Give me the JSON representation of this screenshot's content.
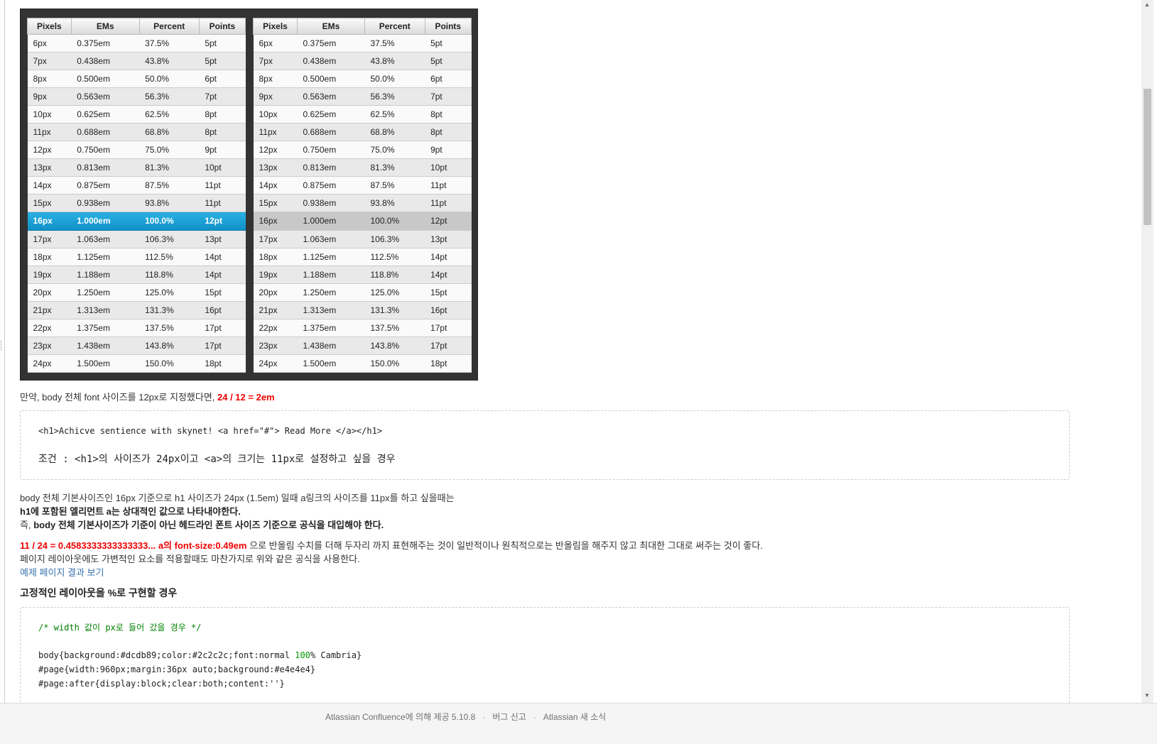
{
  "table": {
    "headers": [
      "Pixels",
      "EMs",
      "Percent",
      "Points"
    ],
    "rows": [
      [
        "6px",
        "0.375em",
        "37.5%",
        "5pt"
      ],
      [
        "7px",
        "0.438em",
        "43.8%",
        "5pt"
      ],
      [
        "8px",
        "0.500em",
        "50.0%",
        "6pt"
      ],
      [
        "9px",
        "0.563em",
        "56.3%",
        "7pt"
      ],
      [
        "10px",
        "0.625em",
        "62.5%",
        "8pt"
      ],
      [
        "11px",
        "0.688em",
        "68.8%",
        "8pt"
      ],
      [
        "12px",
        "0.750em",
        "75.0%",
        "9pt"
      ],
      [
        "13px",
        "0.813em",
        "81.3%",
        "10pt"
      ],
      [
        "14px",
        "0.875em",
        "87.5%",
        "11pt"
      ],
      [
        "15px",
        "0.938em",
        "93.8%",
        "11pt"
      ],
      [
        "16px",
        "1.000em",
        "100.0%",
        "12pt"
      ],
      [
        "17px",
        "1.063em",
        "106.3%",
        "13pt"
      ],
      [
        "18px",
        "1.125em",
        "112.5%",
        "14pt"
      ],
      [
        "19px",
        "1.188em",
        "118.8%",
        "14pt"
      ],
      [
        "20px",
        "1.250em",
        "125.0%",
        "15pt"
      ],
      [
        "21px",
        "1.313em",
        "131.3%",
        "16pt"
      ],
      [
        "22px",
        "1.375em",
        "137.5%",
        "17pt"
      ],
      [
        "23px",
        "1.438em",
        "143.8%",
        "17pt"
      ],
      [
        "24px",
        "1.500em",
        "150.0%",
        "18pt"
      ]
    ],
    "highlight_index": 10,
    "highlight_color_left": "#1aa3d9",
    "highlight_color_right": "#c8c8c8"
  },
  "text": {
    "body_size_note": "만약, body 전체 font 사이즈를 12px로 지정했다면, ",
    "body_size_formula": "24 / 12 = 2em",
    "code1_line1": "<h1>Achicve sentience with skynet! <a href=\"#\"> Read More </a></h1>",
    "code1_condition": "조건 : <h1>의 사이즈가 24px이고 <a>의 크기는 11px로 설정하고 싶을 경우",
    "para1": "body 전체 기본사이즈인 16px 기준으로 h1 사이즈가 24px (1.5em) 일때 a링크의 사이즈를 11px를 하고 싶을때는",
    "para2": "h1에 포함된 엘리먼트 a는 상대적인 값으로 나타내야한다.",
    "para3_prefix": "즉, ",
    "para3_bold": "body 전체 기본사이즈가 기준이 아닌 헤드라인 폰트 사이즈 기준으로 공식을 대입해야 한다.",
    "formula_red": "11 / 24 = 0.4583333333333333... a의 font-size:0.49em",
    "formula_rest": " 으로 반올림 수치를 더해 두자리 까지 표현해주는 것이 일반적이나 원칙적으로는 반올림을 해주지 않고 최대한 그대로 써주는 것이 좋다.",
    "layout_note": "페이지 레이아웃에도 가변적인 요소를 적용할때도 마찬가지로 위와 같은 공식을 사용한다.",
    "example_link": "예제 페이지 결과 보기",
    "fixed_heading": "고정적인 레이아웃을 %로 구현할 경우",
    "code2_comment": "/* width 값이 px로 들어 갔을 경우 */",
    "code2_line1_a": "body{background:#dcdb89;color:#2c2c2c;font:normal ",
    "code2_line1_num": "100",
    "code2_line1_b": "% Cambria}",
    "code2_line2": "#page{width:960px;margin:36px auto;background:#e4e4e4}",
    "code2_line3": "#page:after{display:block;clear:both;content:''}"
  },
  "footer": {
    "powered": "Atlassian Confluence에 의해 제공 5.10.8",
    "bug": "버그 신고",
    "news": "Atlassian 새 소식"
  }
}
